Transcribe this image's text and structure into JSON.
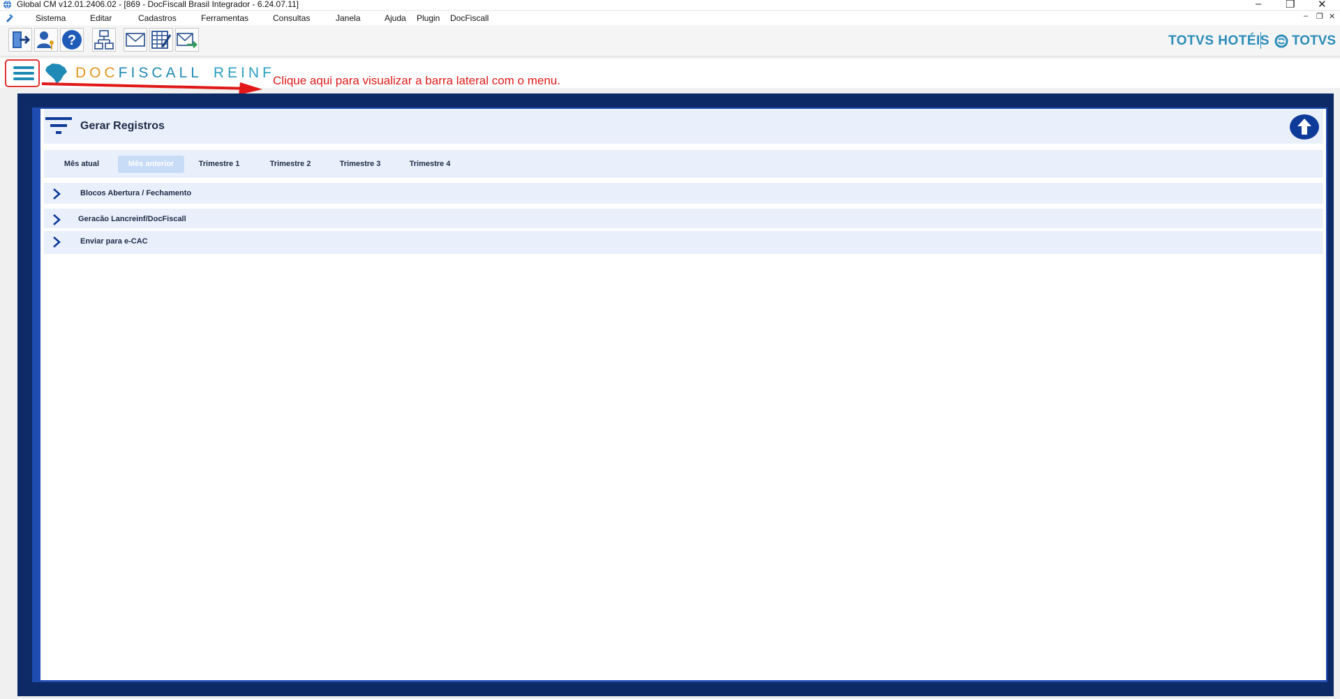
{
  "window": {
    "title": "Global CM v12.01.2406.02 - [869 - DocFiscall Brasil Integrador - 6.24.07.11]",
    "controls": {
      "minimize": "–",
      "restore": "❐",
      "close": "✕"
    }
  },
  "menubar": {
    "items": [
      "Sistema",
      "Editar",
      "Cadastros",
      "Ferramentas",
      "Consultas",
      "Janela",
      "Ajuda",
      "Plugin",
      "DocFiscall"
    ],
    "mdi_controls": {
      "minimize": "–",
      "restore": "❐",
      "close": "✕"
    }
  },
  "toolbar": {
    "icons": [
      "exit-icon",
      "user-key-icon",
      "help-icon",
      "org-chart-icon",
      "mail-icon",
      "spreadsheet-edit-icon",
      "mail-forward-icon"
    ],
    "brand_left": "TOTVS HOTÉIS",
    "brand_right": "TOTVS"
  },
  "header": {
    "logo_doc": "DOC",
    "logo_fiscal": "FISCALL",
    "logo_reinf": "REINF",
    "annotation": "Clique aqui para visualizar a barra lateral com o menu."
  },
  "panel": {
    "title": "Gerar Registros",
    "tabs": [
      {
        "label": "Mês atual",
        "active": false
      },
      {
        "label": "Mês anterior",
        "active": true
      },
      {
        "label": "Trimestre 1",
        "active": false
      },
      {
        "label": "Trimestre 2",
        "active": false
      },
      {
        "label": "Trimestre 3",
        "active": false
      },
      {
        "label": "Trimestre 4",
        "active": false
      }
    ],
    "sections": [
      {
        "label": "Blocos Abertura / Fechamento"
      },
      {
        "label": "Geracão Lancreinf/DocFiscall"
      },
      {
        "label": "Enviar para e-CAC"
      }
    ]
  },
  "colors": {
    "frame_dark": "#0d2a66",
    "frame_blue": "#1e4cb0",
    "panel_bg": "#e9f0fc",
    "accent": "#1f8ab5",
    "annotation": "#e01818"
  }
}
